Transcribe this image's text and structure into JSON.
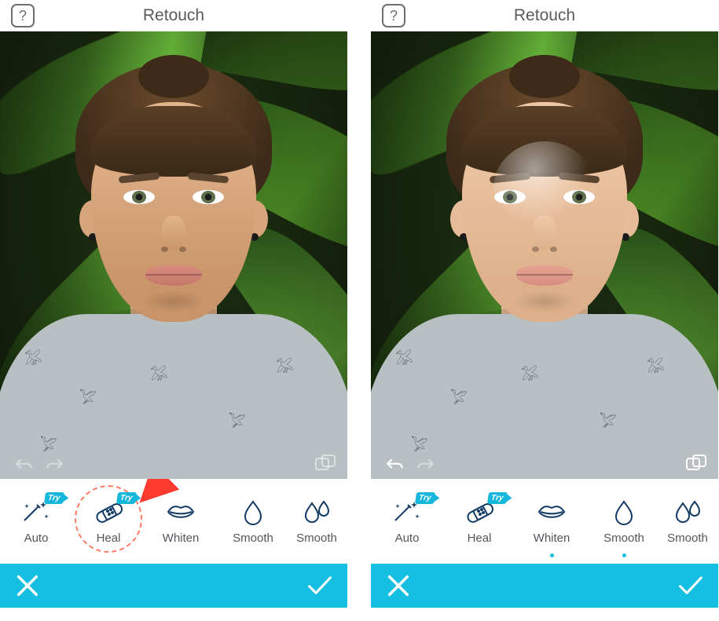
{
  "screens": {
    "left": {
      "title": "Retouch",
      "help_label": "?",
      "undo_enabled": false,
      "redo_enabled": false,
      "compare_enabled": false,
      "highlight_tool": "heal",
      "show_arrow": true
    },
    "right": {
      "title": "Retouch",
      "help_label": "?",
      "undo_enabled": true,
      "redo_enabled": false,
      "compare_enabled": true,
      "highlight_tool": null,
      "show_arrow": false,
      "active_dots": [
        "whiten",
        "smooth"
      ]
    }
  },
  "tools": [
    {
      "id": "auto",
      "label": "Auto",
      "icon": "wand-sparkle-icon",
      "try": true
    },
    {
      "id": "heal",
      "label": "Heal",
      "icon": "bandaid-icon",
      "try": true
    },
    {
      "id": "whiten",
      "label": "Whiten",
      "icon": "lips-icon",
      "try": false
    },
    {
      "id": "smooth",
      "label": "Smooth",
      "icon": "droplet-icon",
      "try": false
    },
    {
      "id": "smooth2",
      "label": "Smooth",
      "icon": "droplets-icon",
      "try": false
    }
  ],
  "badges": {
    "try_text": "Try"
  },
  "colors": {
    "accent": "#14bfe1",
    "highlight_ring": "#ff7a63",
    "arrow": "#ff3b30",
    "tool_icon": "#103a63"
  }
}
